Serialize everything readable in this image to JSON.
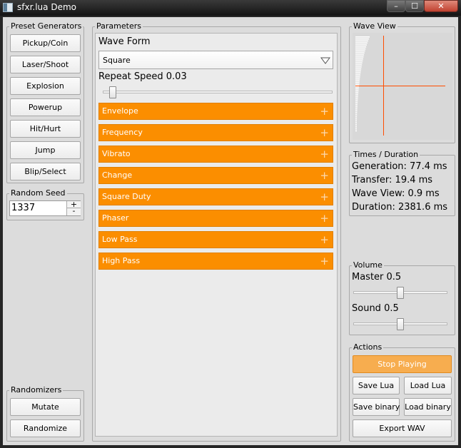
{
  "window": {
    "title": "sfxr.lua Demo",
    "minimize": "–",
    "maximize": "☐",
    "close": "✕"
  },
  "presets": {
    "label": "Preset Generators",
    "buttons": [
      "Pickup/Coin",
      "Laser/Shoot",
      "Explosion",
      "Powerup",
      "Hit/Hurt",
      "Jump",
      "Blip/Select"
    ]
  },
  "seed": {
    "label": "Random Seed",
    "value": "1337",
    "inc": "+",
    "dec": "-"
  },
  "randomizers": {
    "label": "Randomizers",
    "mutate": "Mutate",
    "randomize": "Randomize"
  },
  "parameters": {
    "label": "Parameters",
    "waveform_label": "Wave Form",
    "waveform_value": "Square",
    "repeat_label": "Repeat Speed 0.03",
    "repeat_value": 0.03,
    "sections": [
      "Envelope",
      "Frequency",
      "Vibrato",
      "Change",
      "Square Duty",
      "Phaser",
      "Low Pass",
      "High Pass"
    ]
  },
  "waveview": {
    "label": "Wave View",
    "wave_color": "#ffffff",
    "axis_color": "#ff4d00"
  },
  "times": {
    "label": "Times / Duration",
    "generation": "Generation: 77.4 ms",
    "transfer": "Transfer: 19.4 ms",
    "waveview": "Wave View: 0.9 ms",
    "duration": "Duration: 2381.6 ms"
  },
  "volume": {
    "label": "Volume",
    "master_label": "Master 0.5",
    "master_value": 0.5,
    "sound_label": "Sound 0.5",
    "sound_value": 0.5
  },
  "actions": {
    "label": "Actions",
    "stop": "Stop Playing",
    "save_lua": "Save Lua",
    "load_lua": "Load Lua",
    "save_binary": "Save binary",
    "load_binary": "Load binary",
    "export_wav": "Export WAV",
    "accent_color": "#fb8e00"
  }
}
